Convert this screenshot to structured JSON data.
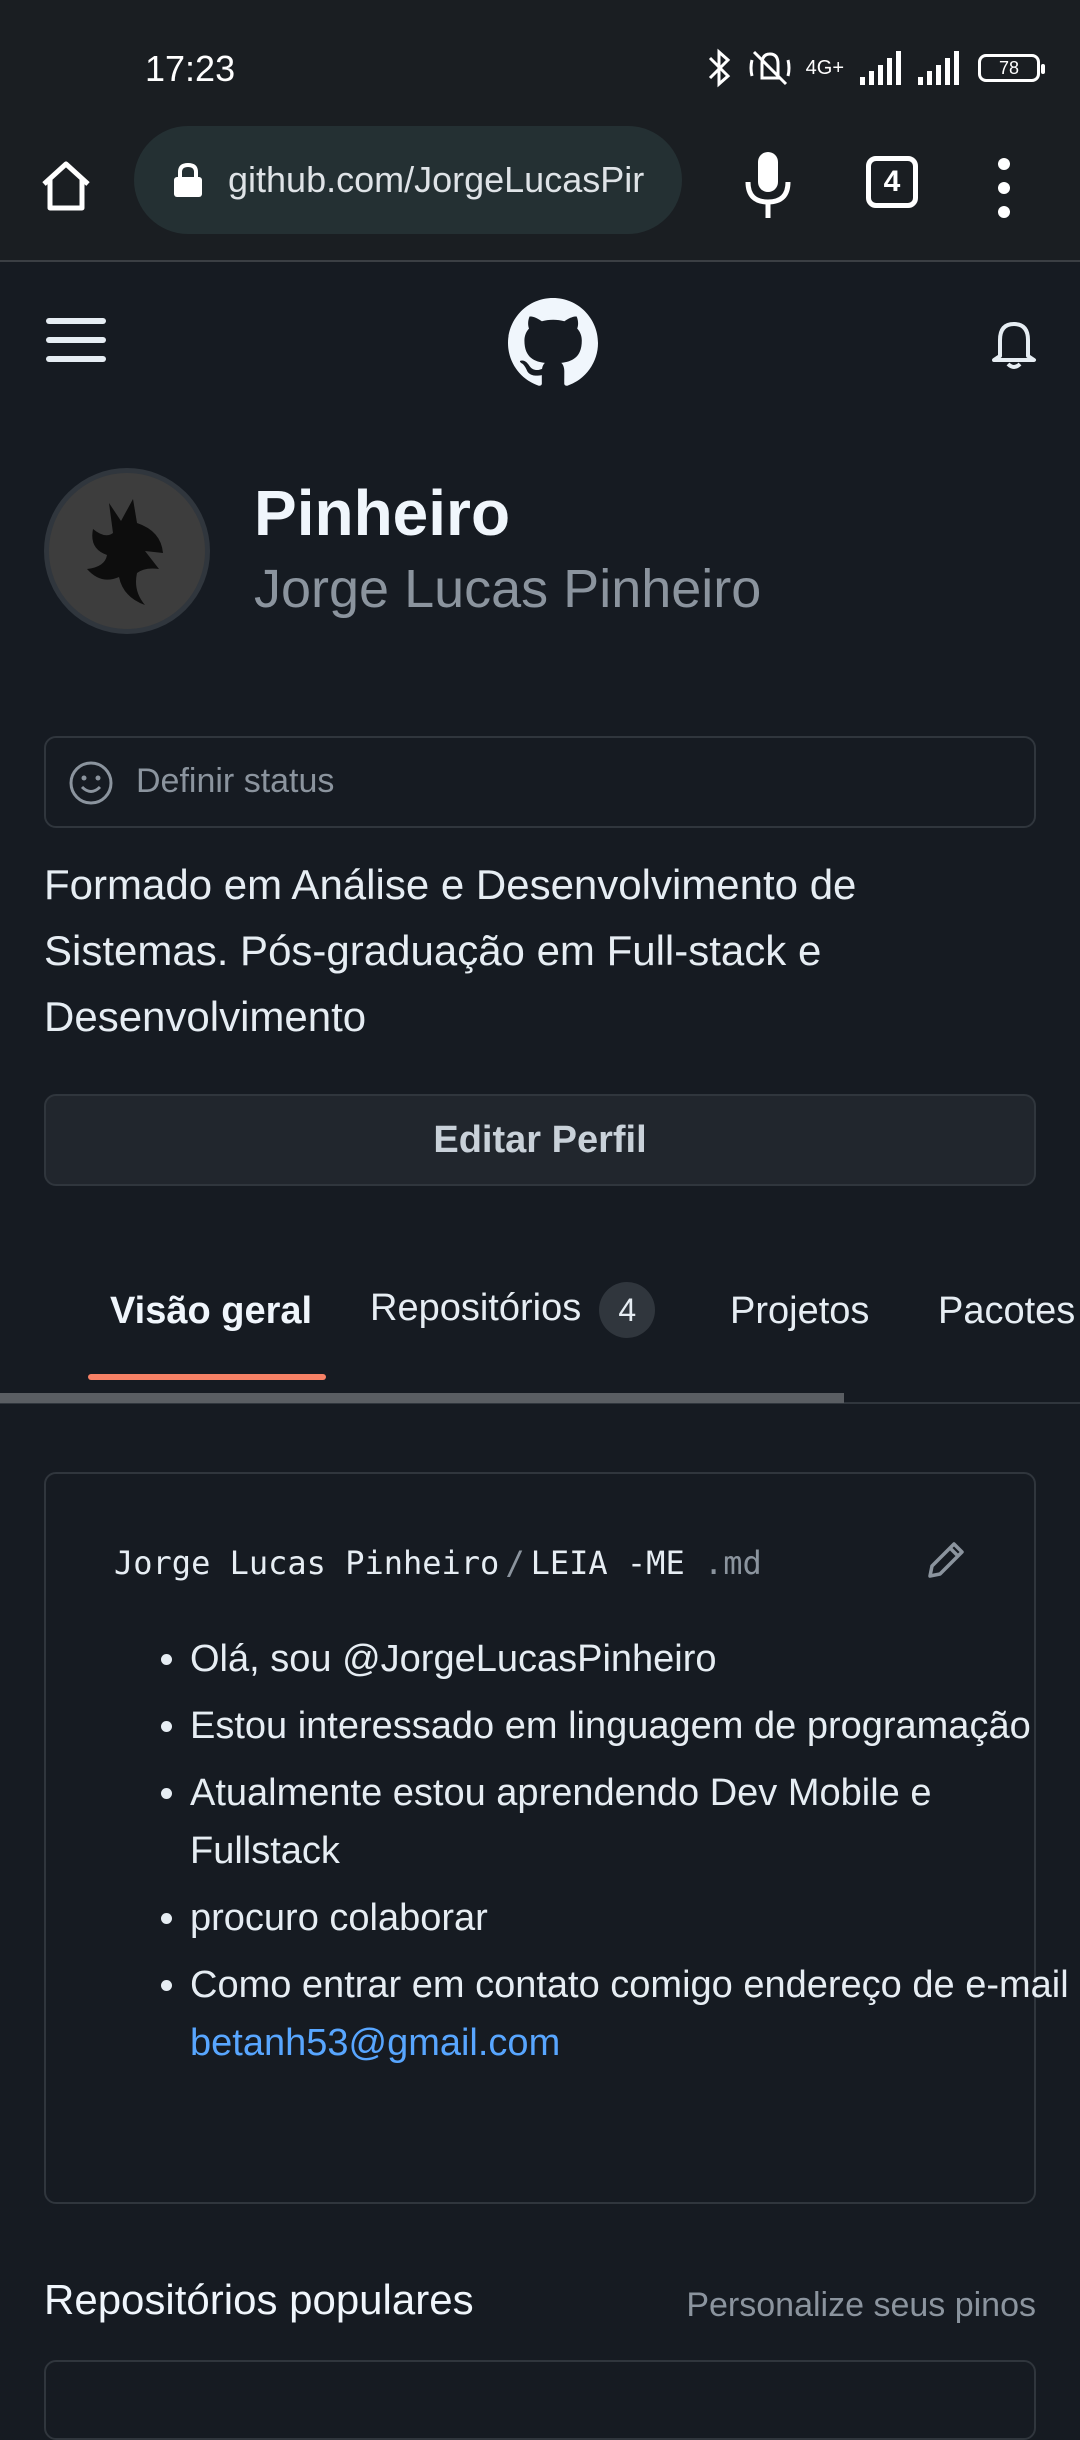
{
  "status_bar": {
    "time": "17:23",
    "network": "4G+",
    "battery": "78"
  },
  "browser": {
    "url": "github.com/JorgeLucasPir",
    "tab_count": "4"
  },
  "profile": {
    "username": "Pinheiro",
    "full_name": "Jorge Lucas Pinheiro",
    "status_placeholder": "Definir status",
    "bio": "Formado em Análise e Desenvolvimento de Sistemas. Pós-graduação em Full-stack e Desenvolvimento",
    "edit_button": "Editar Perfil"
  },
  "tabs": {
    "overview": "Visão geral",
    "repositories": "Repositórios",
    "repositories_count": "4",
    "projects": "Projetos",
    "packages": "Pacotes"
  },
  "readme": {
    "owner": "Jorge Lucas Pinheiro",
    "separator": "/",
    "file": "LEIA -ME",
    "ext": ".md",
    "items": [
      "Olá, sou @JorgeLucasPinheiro",
      "Estou interessado em linguagem de programação",
      "Atualmente estou aprendendo Dev Mobile e Fullstack",
      "procuro colaborar",
      "Como entrar em contato comigo endereço de e-mail "
    ],
    "email": "betanh53@gmail.com"
  },
  "popular": {
    "title": "Repositórios populares",
    "customize": "Personalize seus pinos"
  },
  "colors": {
    "background": "#161b22",
    "accent_underline": "#f78166",
    "link": "#58a6ff"
  }
}
